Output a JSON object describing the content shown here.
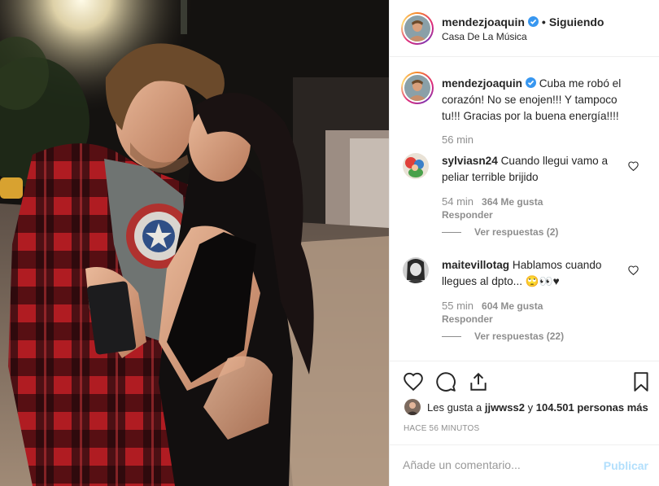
{
  "header": {
    "username": "mendezjoaquin",
    "separator": "•",
    "follow_label": "Siguiendo",
    "location": "Casa De La Música"
  },
  "caption": {
    "username": "mendezjoaquin",
    "text": "Cuba me robó el corazón! No se enojen!!! Y tampoco tu!!! Gracias por la buena energía!!!!",
    "time": "56 min"
  },
  "comments": [
    {
      "username": "sylviasn24",
      "text": "Cuando llegui vamo a peliar terrible brijido",
      "time": "54 min",
      "likes": "364 Me gusta",
      "reply": "Responder",
      "view_replies": "Ver respuestas (2)"
    },
    {
      "username": "maitevillotag",
      "text": "Hablamos cuando llegues al dpto... 🙄👀♥",
      "time": "55 min",
      "likes": "604 Me gusta",
      "reply": "Responder",
      "view_replies": "Ver respuestas (22)"
    }
  ],
  "actions": {
    "icons": [
      "heart-icon",
      "comment-icon",
      "share-icon",
      "bookmark-icon"
    ]
  },
  "likes": {
    "prefix": "Les gusta a",
    "user": "jjwwss2",
    "middle": "y",
    "count": "104.501 personas más"
  },
  "posted": "HACE 56 MINUTOS",
  "add_comment": {
    "placeholder": "Añade un comentario...",
    "publish": "Publicar"
  },
  "colors": {
    "verified": "#3897f0",
    "muted": "#8e8e8e",
    "publish_disabled": "#b2dffc"
  }
}
